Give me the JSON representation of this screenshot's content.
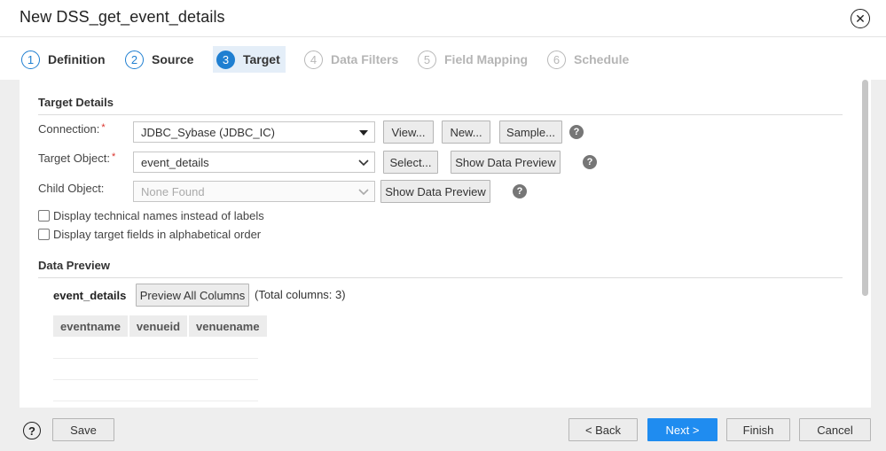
{
  "dialog": {
    "title": "New DSS_get_event_details",
    "close_glyph": "✕"
  },
  "steps": [
    {
      "num": "1",
      "label": "Definition",
      "state": "done"
    },
    {
      "num": "2",
      "label": "Source",
      "state": "done"
    },
    {
      "num": "3",
      "label": "Target",
      "state": "active"
    },
    {
      "num": "4",
      "label": "Data Filters",
      "state": "disabled"
    },
    {
      "num": "5",
      "label": "Field Mapping",
      "state": "disabled"
    },
    {
      "num": "6",
      "label": "Schedule",
      "state": "disabled"
    }
  ],
  "target_details": {
    "title": "Target Details",
    "connection": {
      "label": "Connection:",
      "required": "*",
      "value": "JDBC_Sybase (JDBC_IC)",
      "view_label": "View...",
      "new_label": "New...",
      "sample_label": "Sample..."
    },
    "target_object": {
      "label": "Target Object:",
      "required": "*",
      "value": "event_details",
      "select_label": "Select...",
      "preview_label": "Show Data Preview"
    },
    "child_object": {
      "label": "Child Object:",
      "value": "None Found",
      "preview_label": "Show Data Preview"
    },
    "help_glyph": "?",
    "options": [
      {
        "label": "Display technical names instead of labels",
        "checked": false
      },
      {
        "label": "Display target fields in alphabetical order",
        "checked": false
      }
    ]
  },
  "data_preview": {
    "title": "Data Preview",
    "object_name": "event_details",
    "preview_all_label": "Preview All Columns",
    "total_columns": "(Total columns: 3)",
    "columns": [
      "eventname",
      "venueid",
      "venuename"
    ]
  },
  "footer": {
    "help_glyph": "?",
    "save_label": "Save",
    "back_label": "< Back",
    "next_label": "Next >",
    "finish_label": "Finish",
    "cancel_label": "Cancel"
  },
  "colors": {
    "accent": "#1f7fd1",
    "primary_button": "#1f8cf0",
    "required": "#d9302a"
  }
}
